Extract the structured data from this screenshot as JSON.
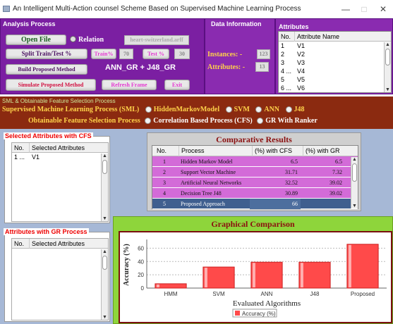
{
  "window": {
    "title": "An Intelligent Multi-Action counsel Scheme Based on Supervised Machine Learning Process",
    "min": "—",
    "max": "□",
    "close": "✕"
  },
  "analysis": {
    "header": "Analysis Process",
    "open_file": "Open File",
    "relation_label": "Relation",
    "relation_value": "heart-switzerland.arff",
    "split_btn": "Split Train/Test %",
    "train_btn": "Train%",
    "train_val": "70",
    "test_btn": "Test %",
    "test_val": "30",
    "build_btn": "Build Proposed Method",
    "method_label": "ANN_GR + J48_GR",
    "simulate_btn": "Simulate Proposed Method",
    "refresh_btn": "Refresh Frame",
    "exit_btn": "Exit"
  },
  "data_info": {
    "header": "Data Information",
    "instances_label": "Instances: -",
    "instances_val": "123",
    "attributes_label": "Attributes: -",
    "attributes_val": "13"
  },
  "attributes": {
    "header": "Attributes",
    "col_no": "No.",
    "col_name": "Attribute Name",
    "rows": [
      {
        "no": "1",
        "name": "V1"
      },
      {
        "no": "2",
        "name": "V2"
      },
      {
        "no": "3",
        "name": "V3"
      },
      {
        "no": "4 ...",
        "name": "V4"
      },
      {
        "no": "5",
        "name": "V5"
      },
      {
        "no": "6 ...",
        "name": "V6"
      }
    ]
  },
  "sml": {
    "header": "SML & Obtainable Feature Selection Process",
    "sml_label": "Supervised Machine Learning Process (SML)",
    "opt1": "HiddenMarkovModel",
    "opt2": "SVM",
    "opt3": "ANN",
    "opt4": "J48",
    "fs_label": "Obtainable Feature Selection Process",
    "fs1": "Correlation Based Process (CFS)",
    "fs2": "GR With Ranker"
  },
  "cfs_panel": {
    "title": "Selected Attributes with CFS",
    "col_no": "No.",
    "col_name": "Selected Attributes",
    "rows": [
      {
        "no": "1 ...",
        "name": "V1"
      }
    ]
  },
  "gr_panel": {
    "title": "Attributes with GR Process",
    "col_no": "No.",
    "col_name": "Selected Attributes"
  },
  "comparative": {
    "title": "Comparative Results",
    "headers": [
      "No.",
      "Process",
      "(%) with CFS",
      "(%) with GR"
    ],
    "rows": [
      [
        "1",
        "Hidden Markov Model",
        "6.5",
        "6.5"
      ],
      [
        "2",
        "Support Vector Machine",
        "31.71",
        "7.32"
      ],
      [
        "3",
        "Artificial Neural Networks",
        "32.52",
        "39.02"
      ],
      [
        "4",
        "Decision Tree J48",
        "30.89",
        "39.02"
      ],
      [
        "5",
        "Proposed Approach",
        "66",
        ""
      ]
    ]
  },
  "graphical": {
    "title": "Graphical Comparison"
  },
  "colors": {
    "bar": "#ff4a4a",
    "purple": "#7b1fa2",
    "brown": "#8b2a10",
    "green": "#8ed53b",
    "magenta": "#d36bd8"
  },
  "chart_data": {
    "type": "bar",
    "categories": [
      "HMM",
      "SVM",
      "ANN",
      "J48",
      "Proposed"
    ],
    "values": [
      6.5,
      31.71,
      39.02,
      39.02,
      66
    ],
    "xlabel": "Evaluated Algorithms",
    "ylabel": "Accuracy (%)",
    "ylim": [
      0,
      70
    ],
    "yticks": [
      "0",
      "20",
      "40",
      "60"
    ],
    "legend": "Accuracy (%)",
    "legend_position": "bottom",
    "grid": true
  }
}
